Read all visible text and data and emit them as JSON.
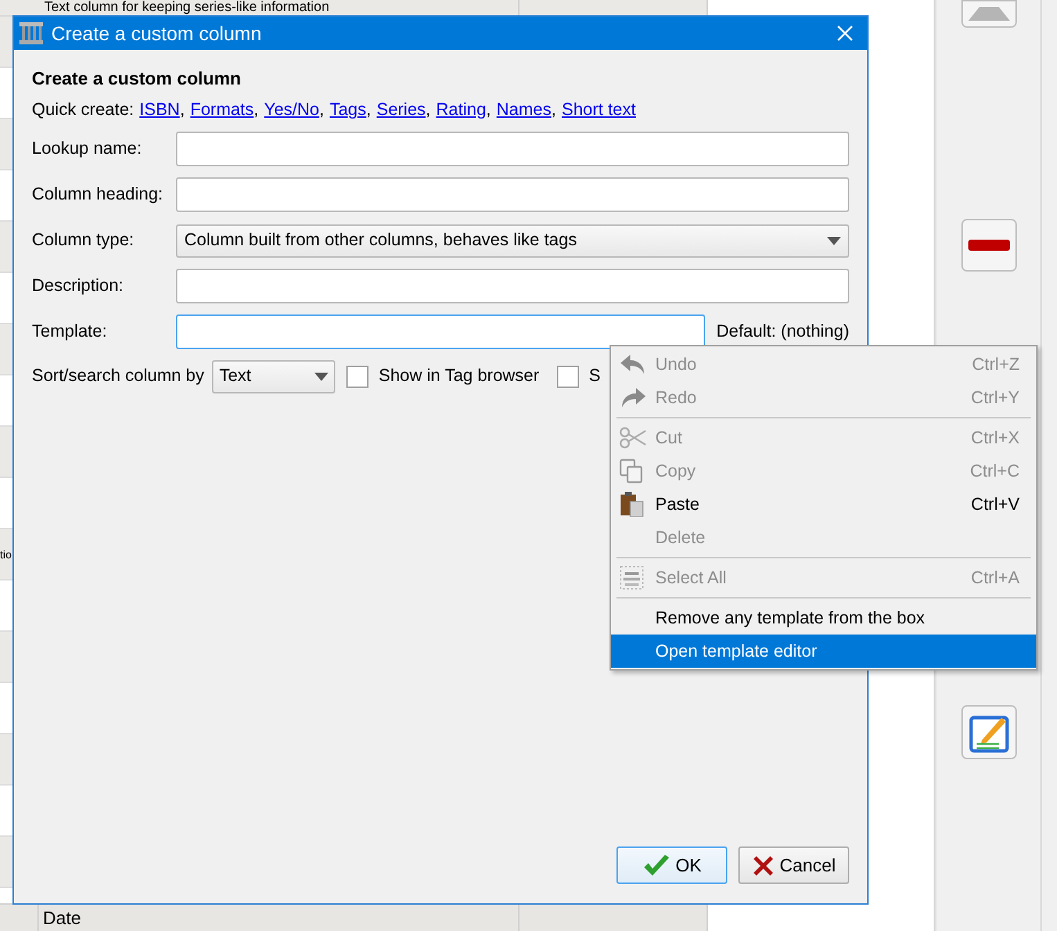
{
  "background": {
    "top_cell": "Text column for keeping series-like information",
    "side_cell": "tio",
    "column_header": "Date"
  },
  "side_toolbar": [
    {
      "kind": "up"
    },
    {
      "kind": "remove"
    },
    {
      "kind": "edit"
    }
  ],
  "dialog": {
    "title": "Create a custom column",
    "heading": "Create a custom column",
    "quick_create": {
      "label": "Quick create:",
      "links": [
        {
          "text": "ISBN",
          "separator": ","
        },
        {
          "text": "Formats",
          "separator": ","
        },
        {
          "text": "Yes/No",
          "separator": ","
        },
        {
          "text": "Tags",
          "separator": ","
        },
        {
          "text": "Series",
          "separator": ","
        },
        {
          "text": "Rating",
          "separator": ","
        },
        {
          "text": "Names",
          "separator": ","
        },
        {
          "text": "Short text"
        }
      ]
    },
    "fields": [
      {
        "label": "Lookup name:",
        "kind": "text",
        "focused": false
      },
      {
        "label": "Column heading:",
        "kind": "text",
        "focused": false
      },
      {
        "label": "Column type:",
        "kind": "select",
        "value": "Column built from other columns, behaves like tags"
      },
      {
        "label": "Description:",
        "kind": "text",
        "focused": false
      },
      {
        "label": "Template:",
        "kind": "text",
        "focused": true,
        "note": "Default: (nothing)"
      }
    ],
    "sort_row": {
      "label": "Sort/search column by",
      "select": "Text",
      "checkboxes": [
        {
          "label": "Show in Tag browser",
          "checked": false
        },
        {
          "label": "S",
          "checked": false
        }
      ]
    },
    "buttons": [
      {
        "label": "OK",
        "kind": "ok",
        "default": true
      },
      {
        "label": "Cancel",
        "kind": "cancel",
        "default": false
      }
    ]
  },
  "context_menu": [
    {
      "kind": "undo",
      "label": "Undo",
      "shortcut": "Ctrl+Z",
      "disabled": true,
      "selected": false
    },
    {
      "kind": "redo",
      "label": "Redo",
      "shortcut": "Ctrl+Y",
      "disabled": true,
      "selected": false
    },
    {
      "kind": "separator"
    },
    {
      "kind": "cut",
      "label": "Cut",
      "shortcut": "Ctrl+X",
      "disabled": true,
      "selected": false
    },
    {
      "kind": "copy",
      "label": "Copy",
      "shortcut": "Ctrl+C",
      "disabled": true,
      "selected": false
    },
    {
      "kind": "paste",
      "label": "Paste",
      "shortcut": "Ctrl+V",
      "disabled": false,
      "selected": false
    },
    {
      "kind": "plain",
      "label": "Delete",
      "disabled": true,
      "selected": false
    },
    {
      "kind": "separator"
    },
    {
      "kind": "selectall",
      "label": "Select All",
      "shortcut": "Ctrl+A",
      "disabled": true,
      "selected": false
    },
    {
      "kind": "separator"
    },
    {
      "kind": "plain",
      "label": "Remove any template from the box",
      "disabled": false,
      "selected": false
    },
    {
      "kind": "plain",
      "label": "Open template editor",
      "disabled": false,
      "selected": true
    }
  ]
}
